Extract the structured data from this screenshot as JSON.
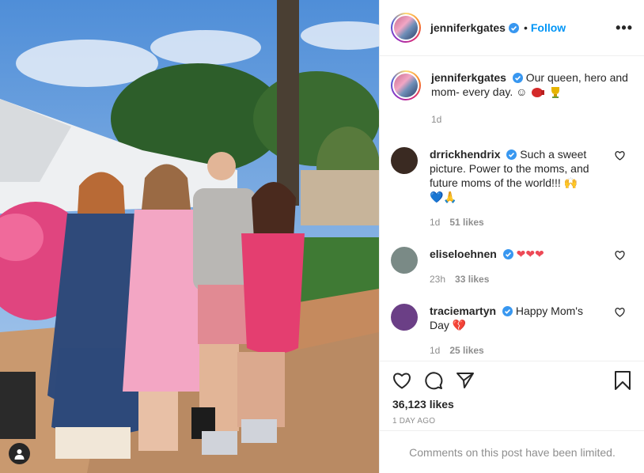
{
  "post": {
    "username": "jenniferkgates",
    "follow_label": "Follow",
    "separator": "•",
    "more_label": "•••",
    "caption_text": "Our queen, hero and mom- every day. ☺",
    "caption_time": "1d",
    "likes": "36,123 likes",
    "time_ago": "1 DAY AGO",
    "comments_limited": "Comments on this post have been limited."
  },
  "comments": [
    {
      "username": "drrickhendrix",
      "text": "Such a sweet picture. Power to the moms, and future moms of the world!!! 🙌",
      "emojis": "💙🙏",
      "time": "1d",
      "likes": "51 likes",
      "avatar_color": "#3a2a22"
    },
    {
      "username": "eliseloehnen",
      "text": "",
      "emojis": "❤❤❤",
      "time": "23h",
      "likes": "33 likes",
      "avatar_color": "#7a8a86"
    },
    {
      "username": "traciemartyn",
      "text": "Happy Mom's Day",
      "emojis": "💔",
      "time": "1d",
      "likes": "25 likes",
      "avatar_color": "#6b3f86"
    }
  ],
  "icons": {
    "verified": "verified-badge-icon",
    "like": "heart-icon",
    "comment": "comment-bubble-icon",
    "share": "paper-plane-icon",
    "save": "bookmark-icon",
    "tag": "user-tag-icon"
  },
  "colors": {
    "accent": "#0095f6",
    "verified": "#3897f0",
    "heart_red": "#ed4956"
  }
}
